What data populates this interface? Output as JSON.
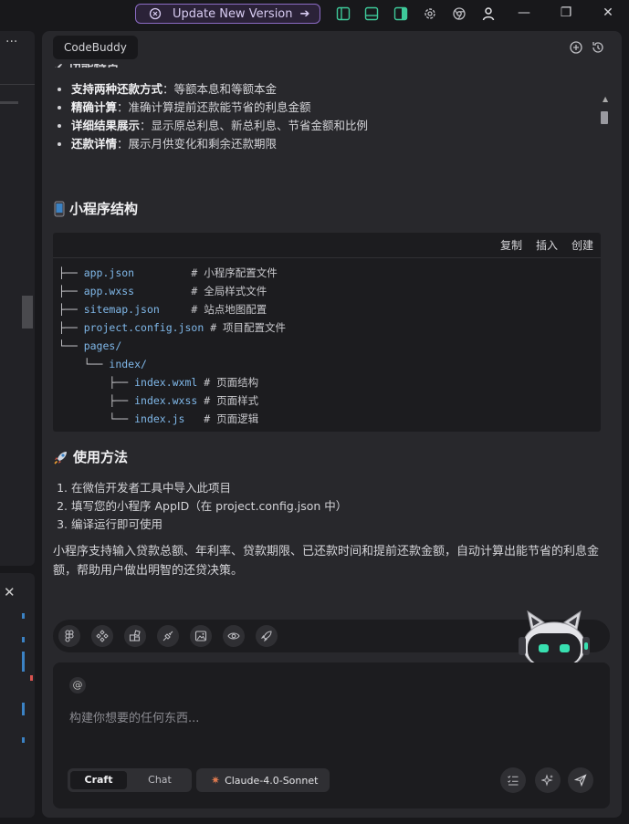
{
  "titlebar": {
    "update_label": "Update New Version",
    "arrow": "➔",
    "icons": [
      "sparkle-icon",
      "layout-sidebar-left-icon",
      "layout-panel-icon",
      "layout-sidebar-right-icon",
      "gear-icon",
      "chrome-icon",
      "user-icon"
    ],
    "window_controls": {
      "minimize": "—",
      "restore": "❐",
      "close": "✕"
    }
  },
  "left_panel": {
    "menu": "···",
    "close": "✕"
  },
  "panel": {
    "tab_label": "CodeBuddy",
    "features": [
      {
        "bold": "支持两种还款方式",
        "text": "：等额本息和等额本金"
      },
      {
        "bold": "精确计算",
        "text": "：准确计算提前还款能节省的利息金额"
      },
      {
        "bold": "详细结果展示",
        "text": "：显示原总利息、新总利息、节省金额和比例"
      },
      {
        "bold": "还款详情",
        "text": "：展示月供变化和剩余还款期限"
      }
    ],
    "section_structure": "小程序结构",
    "code_actions": {
      "copy": "复制",
      "insert": "插入",
      "create": "创建"
    },
    "code_lines": [
      {
        "tree": "├── ",
        "file": "app.json",
        "comment": "         # 小程序配置文件"
      },
      {
        "tree": "├── ",
        "file": "app.wxss",
        "comment": "         # 全局样式文件"
      },
      {
        "tree": "├── ",
        "file": "sitemap.json",
        "comment": "     # 站点地图配置"
      },
      {
        "tree": "├── ",
        "file": "project.config.json",
        "comment": " # 项目配置文件"
      },
      {
        "tree": "└── ",
        "file": "pages/",
        "comment": ""
      },
      {
        "tree": "    └── ",
        "file": "index/",
        "comment": ""
      },
      {
        "tree": "        ├── ",
        "file": "index.wxml",
        "comment": " # 页面结构"
      },
      {
        "tree": "        ├── ",
        "file": "index.wxss",
        "comment": " # 页面样式"
      },
      {
        "tree": "        └── ",
        "file": "index.js",
        "comment": "   # 页面逻辑"
      }
    ],
    "section_usage": "使用方法",
    "steps": [
      "在微信开发者工具中导入此项目",
      "填写您的小程序 AppID（在 project.config.json 中）",
      "编译运行即可使用"
    ],
    "summary": "小程序支持输入贷款总额、年利率、贷款期限、已还款时间和提前还款金额，自动计算出能节省的利息金额，帮助用户做出明智的还贷决策。",
    "input": {
      "at_symbol": "@",
      "placeholder": "构建你想要的任何东西...",
      "mode_craft": "Craft",
      "mode_chat": "Chat",
      "model_name": "Claude-4.0-Sonnet",
      "model_icon": "✷"
    }
  },
  "colors": {
    "accent_purple": "#8b6bc4",
    "code_filename": "#7fb7e8",
    "model_star": "#e07a4f",
    "panel_bg": "#28282c"
  }
}
